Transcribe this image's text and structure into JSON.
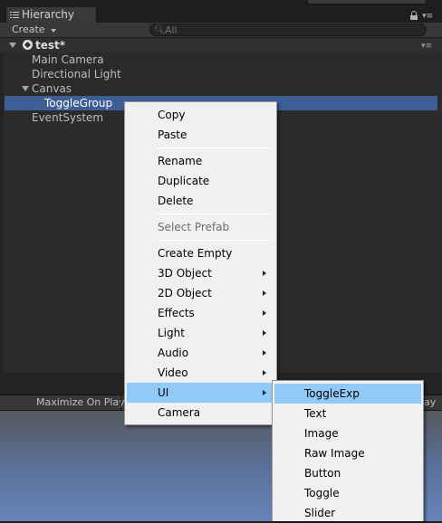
{
  "panel": {
    "tab_title": "Hierarchy",
    "create_label": "Create",
    "search_placeholder": "All"
  },
  "scene": {
    "name": "test*"
  },
  "hierarchy": {
    "items": [
      {
        "label": "Main Camera",
        "depth": 0,
        "selected": false,
        "foldout": false
      },
      {
        "label": "Directional Light",
        "depth": 0,
        "selected": false,
        "foldout": false
      },
      {
        "label": "Canvas",
        "depth": 0,
        "selected": false,
        "foldout": true
      },
      {
        "label": "ToggleGroup",
        "depth": 1,
        "selected": true,
        "foldout": false
      },
      {
        "label": "EventSystem",
        "depth": 0,
        "selected": false,
        "foldout": false
      }
    ]
  },
  "game_bar": {
    "maximize_label": "Maximize On Play",
    "play_fragment": "lay"
  },
  "context_menu": {
    "items": [
      {
        "label": "Copy"
      },
      {
        "label": "Paste"
      },
      {
        "separator": true
      },
      {
        "label": "Rename"
      },
      {
        "label": "Duplicate"
      },
      {
        "label": "Delete"
      },
      {
        "separator": true
      },
      {
        "label": "Select Prefab",
        "disabled": true
      },
      {
        "separator": true
      },
      {
        "label": "Create Empty"
      },
      {
        "label": "3D Object",
        "submenu": true
      },
      {
        "label": "2D Object",
        "submenu": true
      },
      {
        "label": "Effects",
        "submenu": true
      },
      {
        "label": "Light",
        "submenu": true
      },
      {
        "label": "Audio",
        "submenu": true
      },
      {
        "label": "Video",
        "submenu": true
      },
      {
        "label": "UI",
        "submenu": true,
        "highlighted": true
      },
      {
        "label": "Camera"
      }
    ]
  },
  "ui_submenu": {
    "items": [
      {
        "label": "ToggleExp",
        "highlighted": true
      },
      {
        "label": "Text"
      },
      {
        "label": "Image"
      },
      {
        "label": "Raw Image"
      },
      {
        "label": "Button"
      },
      {
        "label": "Toggle"
      },
      {
        "label": "Slider"
      }
    ]
  },
  "colors": {
    "selection": "#3e5f96",
    "menu_highlight": "#91c9f7",
    "panel_bg": "#2b2b2b",
    "menu_bg": "#f0f0f0"
  }
}
